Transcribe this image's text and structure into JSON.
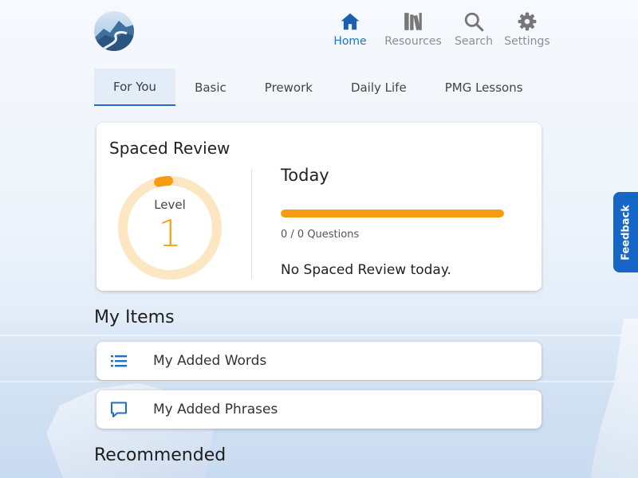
{
  "nav": [
    {
      "label": "Home",
      "icon": "home-icon",
      "active": true
    },
    {
      "label": "Resources",
      "icon": "books-icon"
    },
    {
      "label": "Search",
      "icon": "search-icon"
    },
    {
      "label": "Settings",
      "icon": "gear-icon"
    }
  ],
  "tabs": [
    {
      "label": "For You",
      "active": true
    },
    {
      "label": "Basic"
    },
    {
      "label": "Prework"
    },
    {
      "label": "Daily Life"
    },
    {
      "label": "PMG Lessons"
    }
  ],
  "spaced_review": {
    "title": "Spaced Review",
    "level_label": "Level",
    "level": "1",
    "today_label": "Today",
    "progress": 0,
    "questions": "0 / 0 Questions",
    "message": "No Spaced Review today."
  },
  "my_items": {
    "title": "My Items",
    "items": [
      {
        "label": "My Added Words",
        "icon": "list-icon"
      },
      {
        "label": "My Added Phrases",
        "icon": "speech-bubble-icon"
      }
    ]
  },
  "recommended": {
    "title": "Recommended"
  },
  "feedback_label": "Feedback",
  "colors": {
    "accent": "#1a73c8",
    "orange": "#f79c11",
    "ring_track": "#fde6c2",
    "nav_inactive": "#8a8f96",
    "feedback_bg": "#1566c6"
  }
}
